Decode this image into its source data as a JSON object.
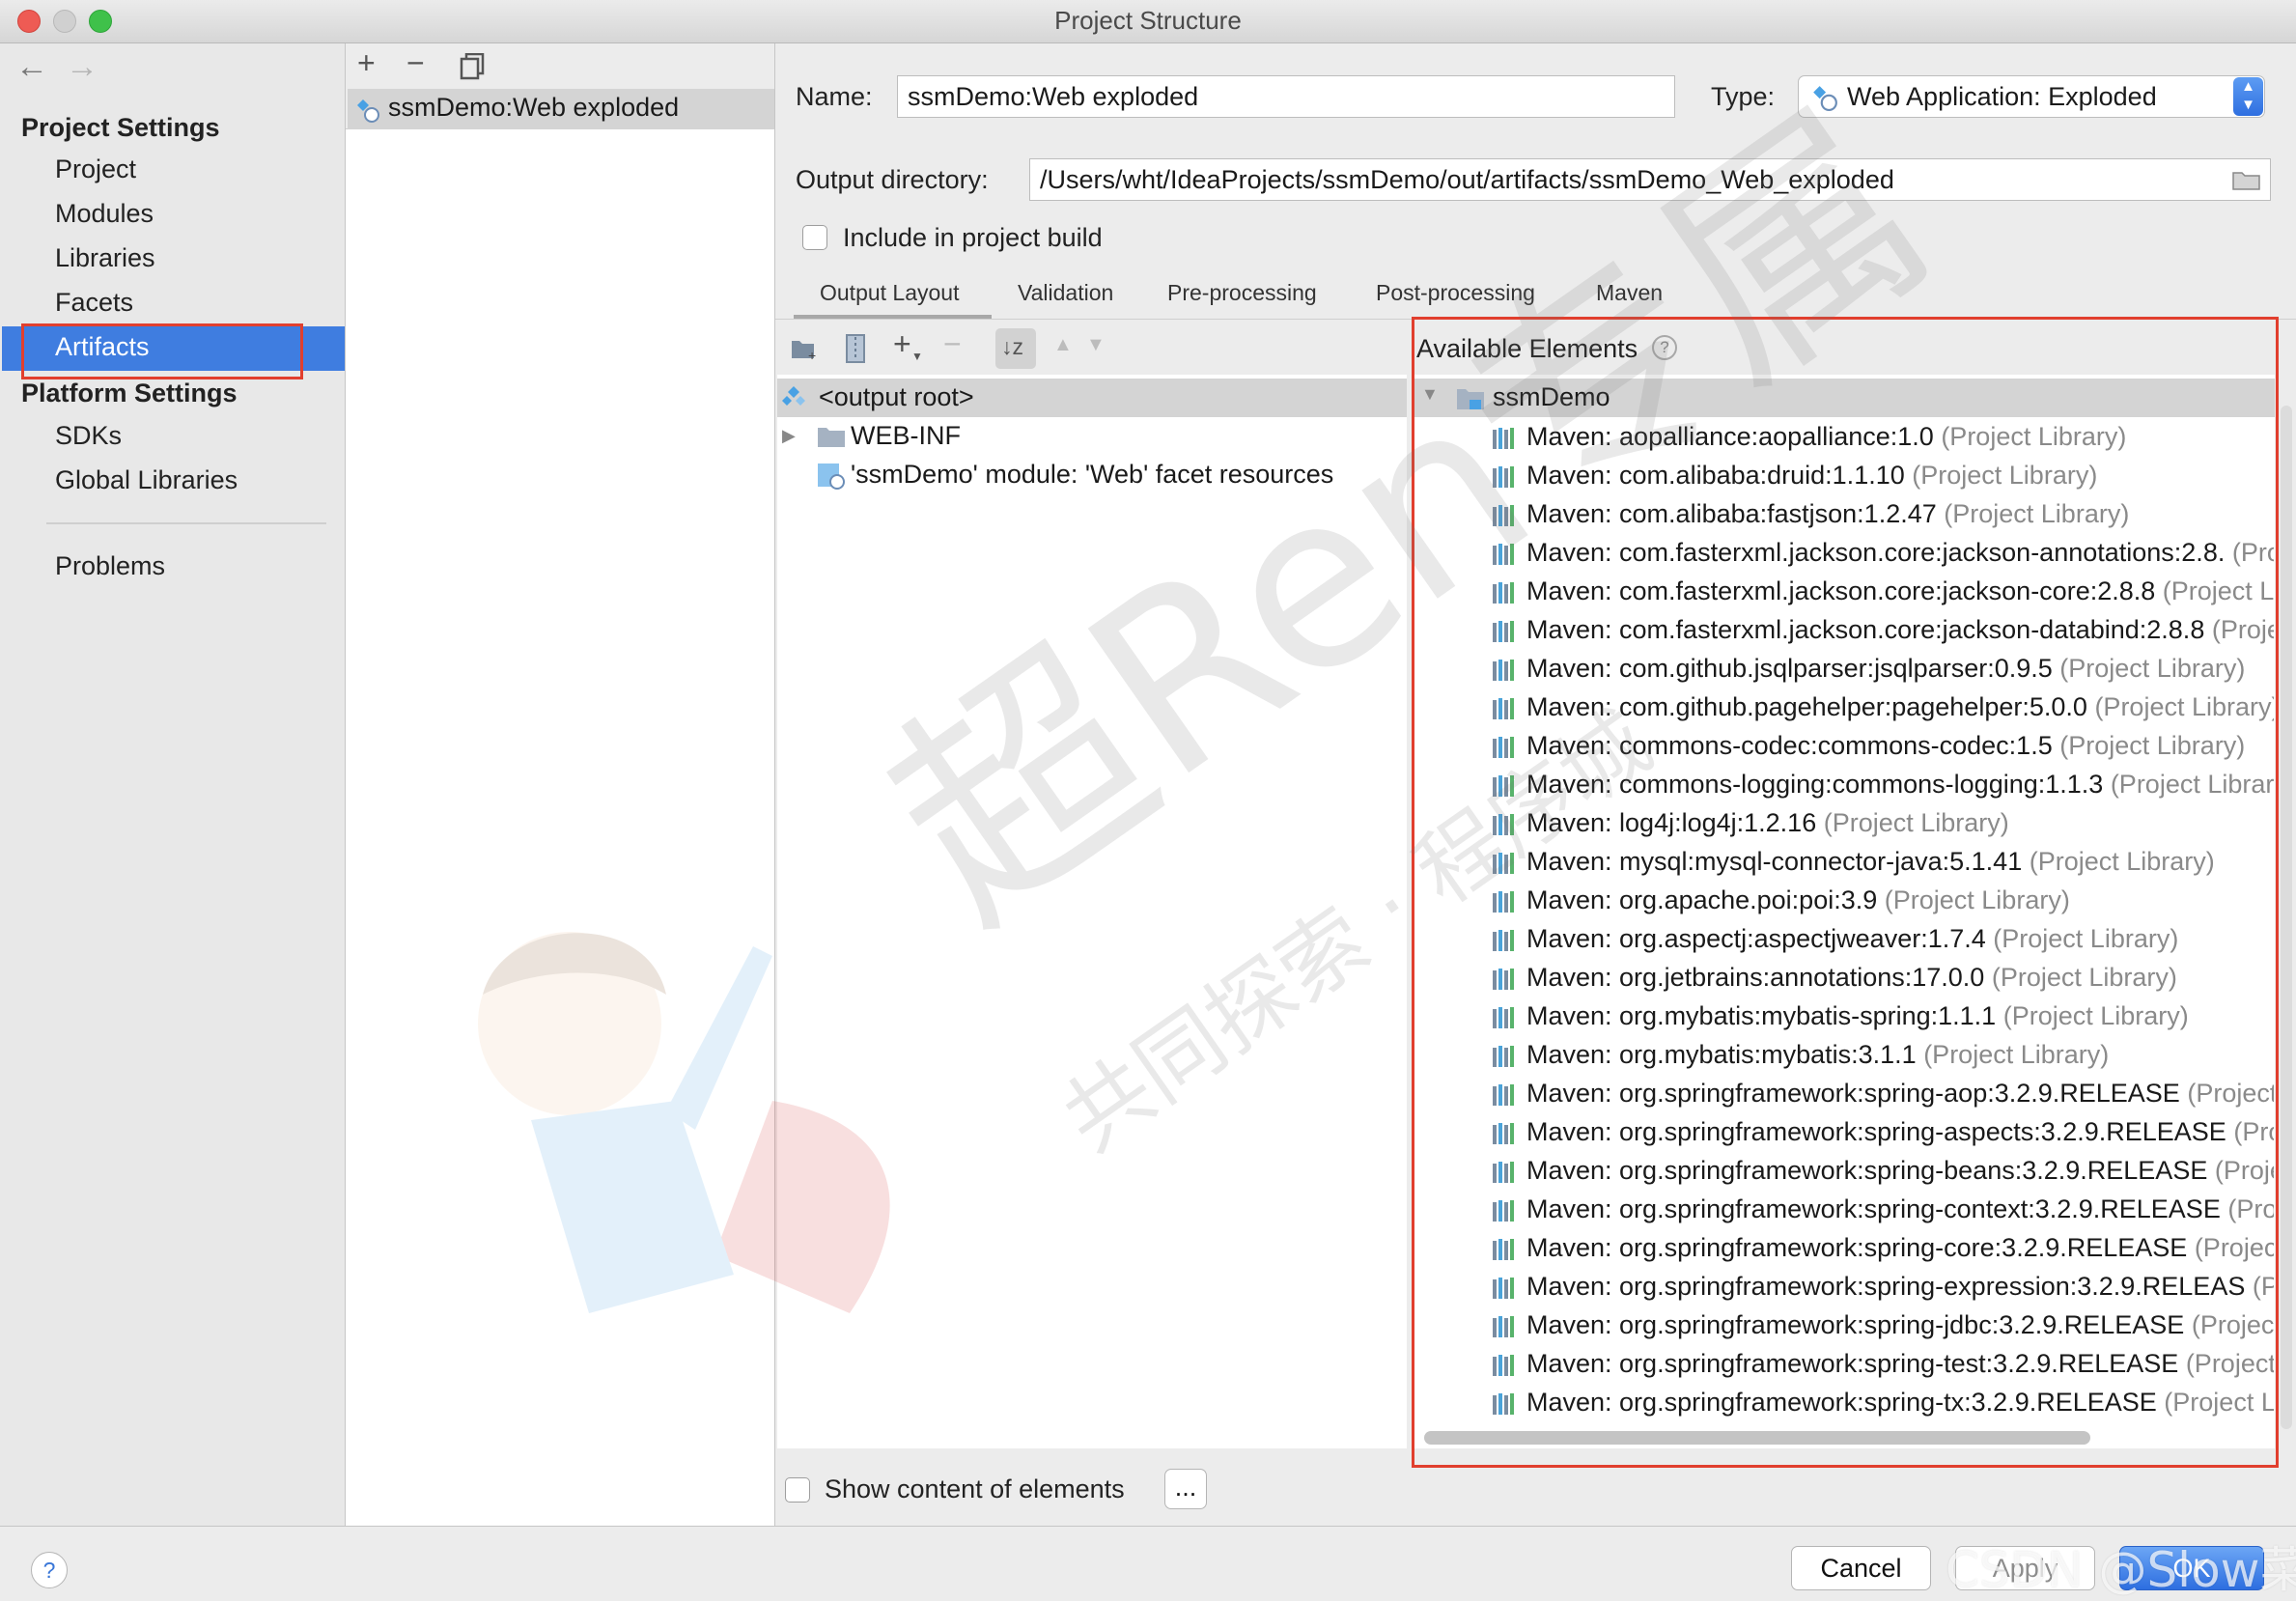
{
  "window": {
    "title": "Project Structure"
  },
  "colors": {
    "accent": "#3f7de0",
    "highlight_box": "#e13f2e"
  },
  "sidebar": {
    "project_settings_header": "Project Settings",
    "project_items": [
      "Project",
      "Modules",
      "Libraries",
      "Facets",
      "Artifacts"
    ],
    "selected": "Artifacts",
    "platform_settings_header": "Platform Settings",
    "platform_items": [
      "SDKs",
      "Global Libraries"
    ],
    "problems": "Problems"
  },
  "artifacts_list": {
    "items": [
      "ssmDemo:Web exploded"
    ]
  },
  "form": {
    "name_label": "Name:",
    "name_value": "ssmDemo:Web exploded",
    "type_label": "Type:",
    "type_value": "Web Application: Exploded",
    "output_label": "Output directory:",
    "output_value": "/Users/wht/IdeaProjects/ssmDemo/out/artifacts/ssmDemo_Web_exploded",
    "include_label": "Include in project build",
    "include_checked": false
  },
  "tabs": [
    "Output Layout",
    "Validation",
    "Pre-processing",
    "Post-processing",
    "Maven"
  ],
  "active_tab": "Output Layout",
  "output_layout": {
    "root": "<output root>",
    "web_inf": "WEB-INF",
    "facet_resources": "'ssmDemo' module: 'Web' facet resources"
  },
  "available_elements": {
    "header": "Available Elements",
    "module": "ssmDemo",
    "project_library_suffix": "(Project Library)",
    "libraries": [
      "Maven: aopalliance:aopalliance:1.0",
      "Maven: com.alibaba:druid:1.1.10",
      "Maven: com.alibaba:fastjson:1.2.47",
      "Maven: com.fasterxml.jackson.core:jackson-annotations:2.8.",
      "Maven: com.fasterxml.jackson.core:jackson-core:2.8.8",
      "Maven: com.fasterxml.jackson.core:jackson-databind:2.8.8",
      "Maven: com.github.jsqlparser:jsqlparser:0.9.5",
      "Maven: com.github.pagehelper:pagehelper:5.0.0",
      "Maven: commons-codec:commons-codec:1.5",
      "Maven: commons-logging:commons-logging:1.1.3",
      "Maven: log4j:log4j:1.2.16",
      "Maven: mysql:mysql-connector-java:5.1.41",
      "Maven: org.apache.poi:poi:3.9",
      "Maven: org.aspectj:aspectjweaver:1.7.4",
      "Maven: org.jetbrains:annotations:17.0.0",
      "Maven: org.mybatis:mybatis-spring:1.1.1",
      "Maven: org.mybatis:mybatis:3.1.1",
      "Maven: org.springframework:spring-aop:3.2.9.RELEASE",
      "Maven: org.springframework:spring-aspects:3.2.9.RELEASE",
      "Maven: org.springframework:spring-beans:3.2.9.RELEASE",
      "Maven: org.springframework:spring-context:3.2.9.RELEASE",
      "Maven: org.springframework:spring-core:3.2.9.RELEASE",
      "Maven: org.springframework:spring-expression:3.2.9.RELEAS",
      "Maven: org.springframework:spring-jdbc:3.2.9.RELEASE",
      "Maven: org.springframework:spring-test:3.2.9.RELEASE",
      "Maven: org.springframework:spring-tx:3.2.9.RELEASE"
    ]
  },
  "show_content_label": "Show content of elements",
  "more_button": "...",
  "buttons": {
    "cancel": "Cancel",
    "apply": "Apply",
    "ok": "OK"
  },
  "help_icon_label": "?",
  "watermark": {
    "brand": "超Ren专属",
    "sub": "共同探索 · 程序城",
    "corner": "CSDN @Slow菜鸟"
  }
}
